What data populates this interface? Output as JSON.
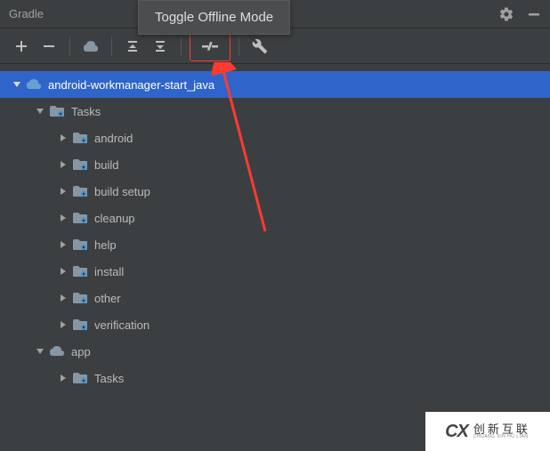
{
  "header": {
    "title": "Gradle"
  },
  "tooltip": {
    "text": "Toggle Offline Mode"
  },
  "tree": {
    "project": {
      "label": "android-workmanager-start_java",
      "expanded": true,
      "selected": true
    },
    "tasks": {
      "label": "Tasks",
      "expanded": true,
      "children": [
        {
          "label": "android",
          "expanded": false
        },
        {
          "label": "build",
          "expanded": false
        },
        {
          "label": "build setup",
          "expanded": false
        },
        {
          "label": "cleanup",
          "expanded": false
        },
        {
          "label": "help",
          "expanded": false
        },
        {
          "label": "install",
          "expanded": false
        },
        {
          "label": "other",
          "expanded": false
        },
        {
          "label": "verification",
          "expanded": false
        }
      ]
    },
    "app": {
      "label": "app",
      "expanded": true,
      "children": [
        {
          "label": "Tasks",
          "expanded": false
        }
      ]
    }
  },
  "watermark": {
    "name": "创新互联",
    "sub": "CHUANG XIN HU LIAN"
  }
}
